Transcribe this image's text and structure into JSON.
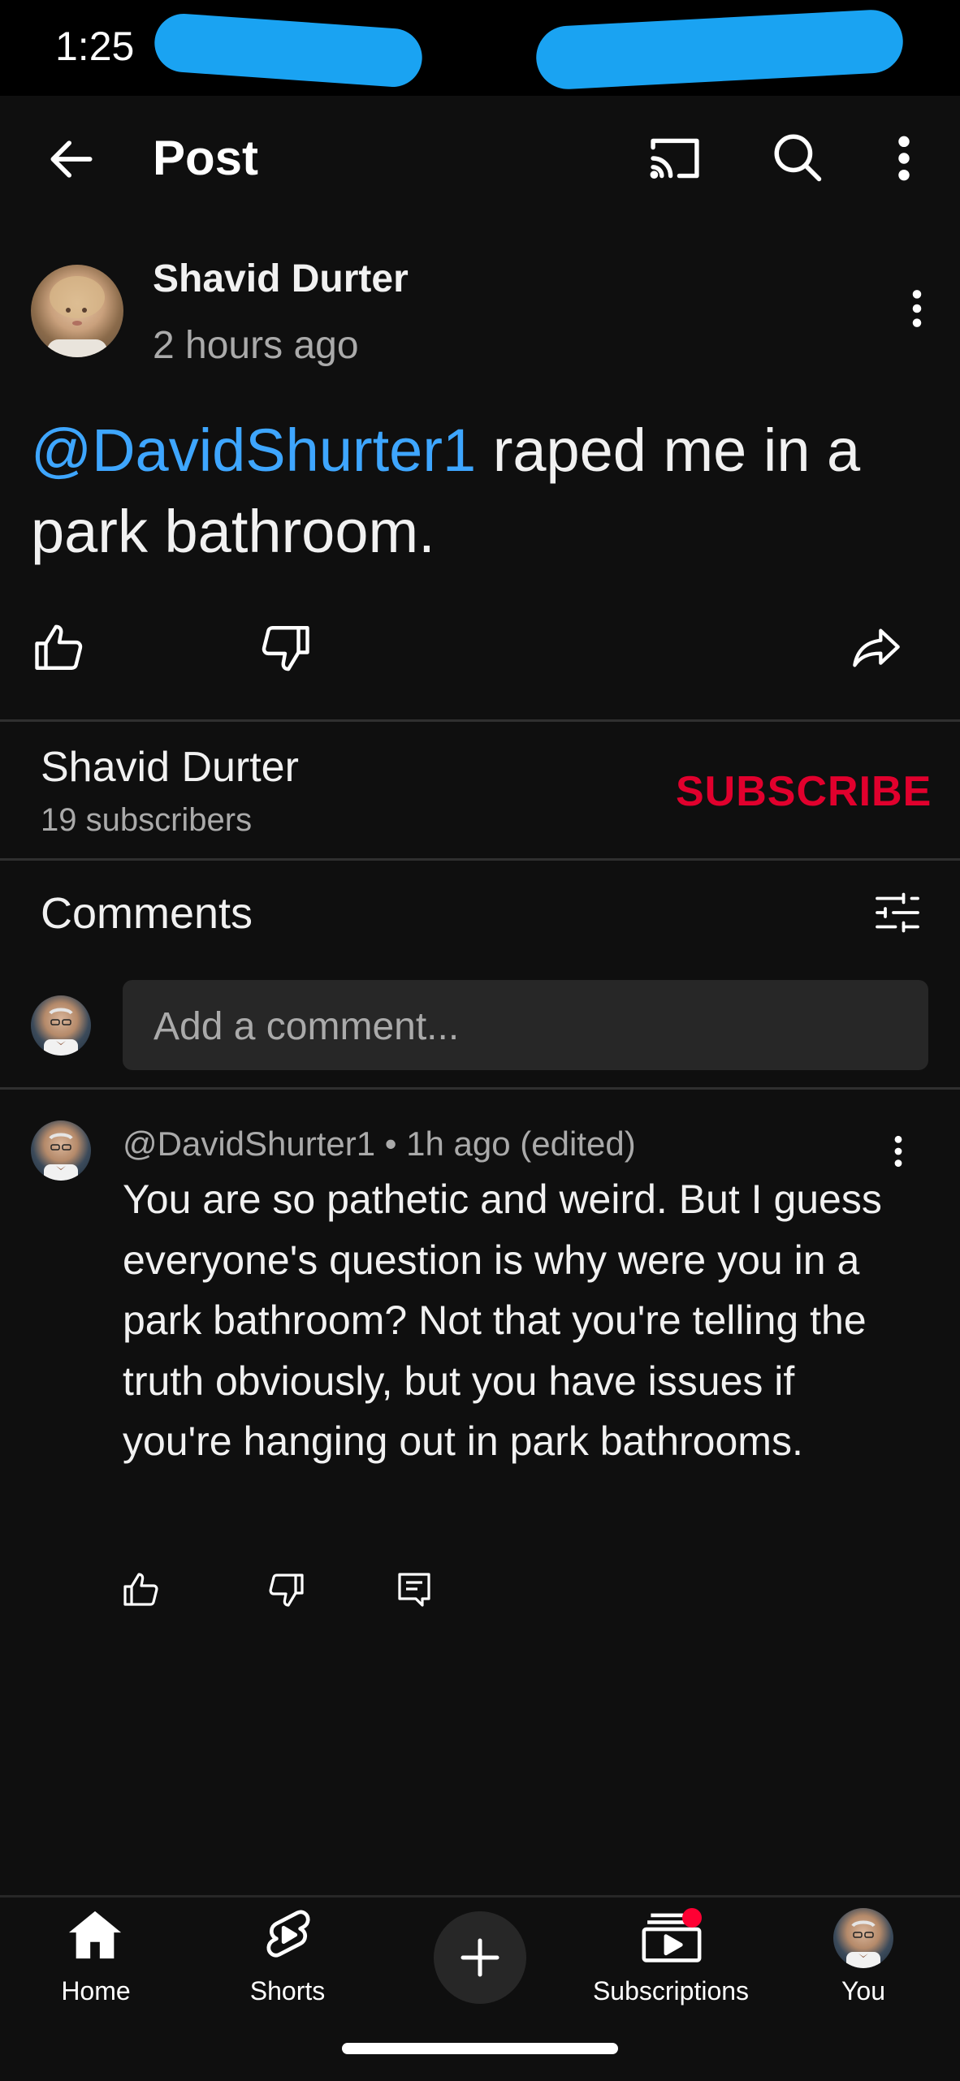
{
  "status_bar": {
    "time": "1:25"
  },
  "app_bar": {
    "title": "Post",
    "icons": [
      "back-arrow-icon",
      "cast-icon",
      "search-icon",
      "more-vert-icon"
    ]
  },
  "post": {
    "author": "Shavid Durter",
    "time": "2 hours ago",
    "mention": "@DavidShurter1",
    "text": " raped me in a park bathroom."
  },
  "channel": {
    "name": "Shavid Durter",
    "subscribers": "19 subscribers",
    "subscribe_label": "SUBSCRIBE"
  },
  "comments": {
    "title": "Comments",
    "input_placeholder": "Add a comment...",
    "items": [
      {
        "meta": "@DavidShurter1 • 1h ago (edited)",
        "text": "You are so pathetic and weird. But I guess everyone's question is why were you in a park bathroom? Not that you're telling the truth obviously, but you have issues if you're hanging out in park bathrooms."
      }
    ]
  },
  "bottom_nav": {
    "items": [
      {
        "label": "Home"
      },
      {
        "label": "Shorts"
      },
      {
        "label": ""
      },
      {
        "label": "Subscriptions"
      },
      {
        "label": "You"
      }
    ]
  },
  "colors": {
    "accent": "#3ea6ff",
    "subscribe": "#e1002d",
    "background": "#0f0f0f",
    "redaction": "#1aa3f2"
  }
}
